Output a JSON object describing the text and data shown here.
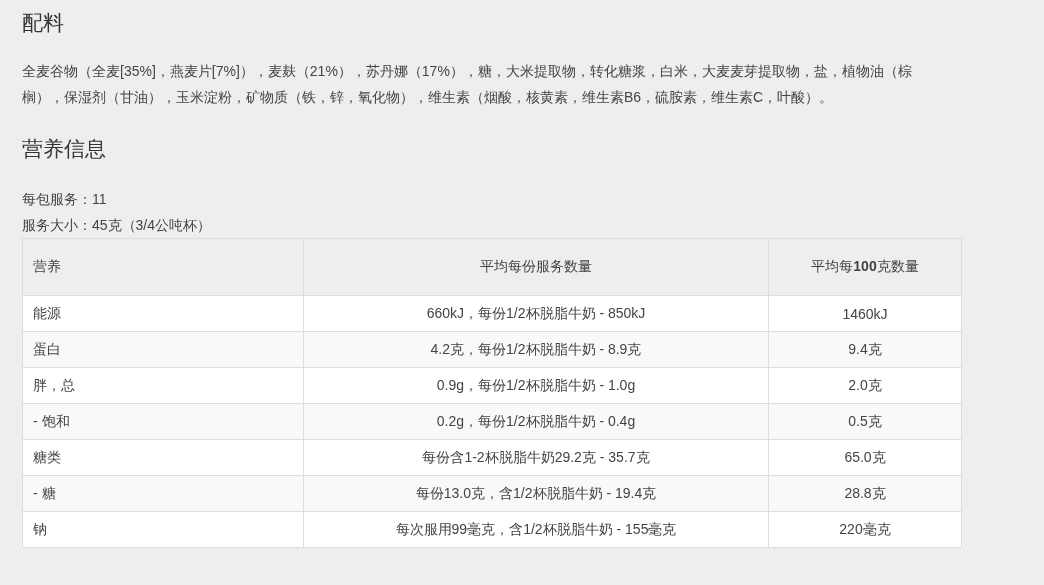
{
  "ingredients": {
    "heading": "配料",
    "text": "全麦谷物（全麦[35%]，燕麦片[7%]），麦麸（21%），苏丹娜（17%），糖，大米提取物，转化糖浆，白米，大麦麦芽提取物，盐，植物油（棕榈），保湿剂（甘油），玉米淀粉，矿物质（铁，锌，氧化物），维生素（烟酸，核黄素，维生素B6，硫胺素，维生素C，叶酸）。"
  },
  "nutrition": {
    "heading": "营养信息",
    "facts": [
      "每包服务：11",
      "服务大小：45克（3/4公吨杯）"
    ],
    "table": {
      "columns": [
        "营养",
        "平均每份服务数量",
        "平均每**100**克数量"
      ],
      "rows": [
        [
          "能源",
          "660kJ，每份1/2杯脱脂牛奶 - 850kJ",
          "1460kJ"
        ],
        [
          "蛋白",
          "4.2克，每份1/2杯脱脂牛奶 - 8.9克",
          "9.4克"
        ],
        [
          "胖，总",
          "0.9g，每份1/2杯脱脂牛奶 - 1.0g",
          "2.0克"
        ],
        [
          "- 饱和",
          "0.2g，每份1/2杯脱脂牛奶 - 0.4g",
          "0.5克"
        ],
        [
          "糖类",
          "每份含1-2杯脱脂牛奶29.2克 - 35.7克",
          "65.0克"
        ],
        [
          "- 糖",
          "每份13.0克，含1/2杯脱脂牛奶 - 19.4克",
          "28.8克"
        ],
        [
          "钠",
          "每次服用99毫克，含1/2杯脱脂牛奶 - 155毫克",
          "220毫克"
        ]
      ]
    }
  }
}
